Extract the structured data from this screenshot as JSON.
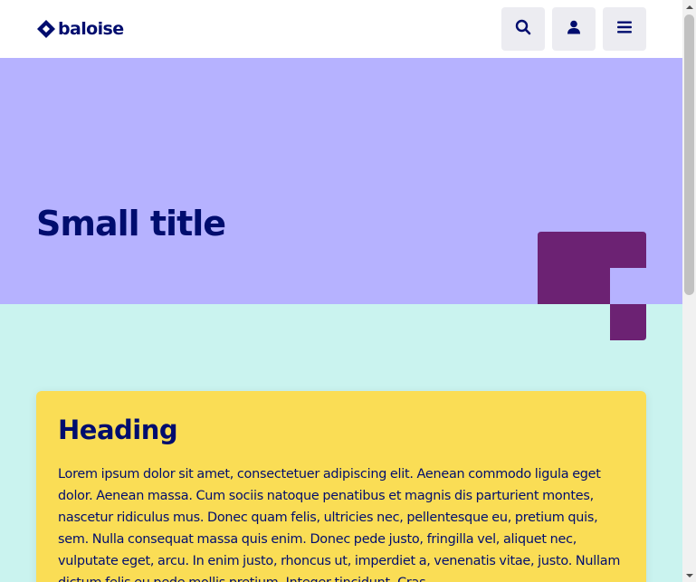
{
  "header": {
    "logo_text": "baloise",
    "buttons": [
      {
        "label": "Search",
        "icon": "search-icon"
      },
      {
        "label": "Account",
        "icon": "user-icon"
      },
      {
        "label": "Menu",
        "icon": "menu-icon"
      }
    ]
  },
  "hero": {
    "title": "Small title"
  },
  "card": {
    "heading": "Heading",
    "text": "Lorem ipsum dolor sit amet, consectetuer adipiscing elit. Aenean commodo ligula eget dolor. Aenean massa. Cum sociis natoque penatibus et magnis dis parturient montes, nascetur ridiculus mus. Donec quam felis, ultricies nec, pellentesque eu, pretium quis, sem. Nulla consequat massa quis enim. Donec pede justo, fringilla vel, aliquet nec, vulputate eget, arcu. In enim justo, rhoncus ut, imperdiet a, venenatis vitae, justo. Nullam dictum felis eu pede mollis pretium. Integer tincidunt. Cras"
  },
  "colors": {
    "brand_blue": "#000d6e",
    "hero_bg": "#b6b2ff",
    "page_bg": "#caf3ef",
    "card_bg": "#fadd55",
    "deco_purple": "#6c2273"
  }
}
